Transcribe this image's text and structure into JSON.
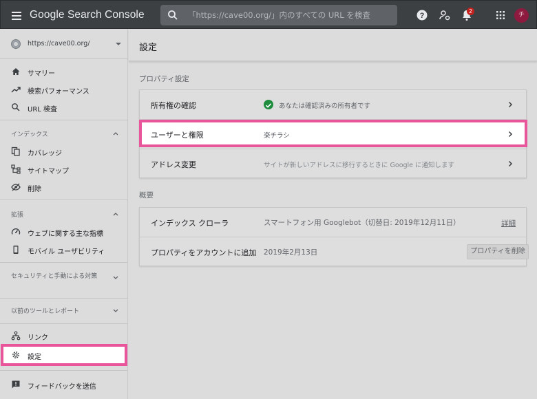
{
  "app": {
    "logo_text": "Google Search Console",
    "search_placeholder": "「https://cave00.org/」内のすべての URL を検査",
    "notification_count": "2",
    "avatar_letter": "チ"
  },
  "sidebar": {
    "property_url": "https://cave00.org/",
    "items_top": [
      {
        "label": "サマリー",
        "icon": "home-icon"
      },
      {
        "label": "検索パフォーマンス",
        "icon": "trending-up-icon"
      },
      {
        "label": "URL 検査",
        "icon": "search-icon"
      }
    ],
    "section_index": {
      "label": "インデックス",
      "items": [
        {
          "label": "カバレッジ",
          "icon": "file-copy-icon"
        },
        {
          "label": "サイトマップ",
          "icon": "sitemap-icon"
        },
        {
          "label": "削除",
          "icon": "visibility-off-icon"
        }
      ]
    },
    "section_enhancements": {
      "label": "拡張",
      "items": [
        {
          "label": "ウェブに関する主な指標",
          "icon": "speed-icon"
        },
        {
          "label": "モバイル ユーザビリティ",
          "icon": "smartphone-icon"
        }
      ]
    },
    "section_security": {
      "label": "セキュリティと手動による対策"
    },
    "section_legacy": {
      "label": "以前のツールとレポート"
    },
    "items_bottom": [
      {
        "label": "リンク",
        "icon": "links-icon"
      },
      {
        "label": "設定",
        "icon": "settings-icon"
      }
    ],
    "feedback": {
      "label": "フィードバックを送信",
      "icon": "feedback-icon"
    }
  },
  "main": {
    "page_title": "設定",
    "property_settings": {
      "title": "プロパティ設定",
      "rows": [
        {
          "label": "所有権の確認",
          "value": "あなたは確認済みの所有者です"
        },
        {
          "label": "ユーザーと権限",
          "value": "楽チラシ"
        },
        {
          "label": "アドレス変更",
          "value": "サイトが新しいアドレスに移行するときに Google に通知します"
        }
      ]
    },
    "overview": {
      "title": "概要",
      "rows": [
        {
          "label": "インデックス クローラ",
          "value": "スマートフォン用 Googlebot（切替日: 2019年12月11日）",
          "action": "詳細"
        },
        {
          "label": "プロパティをアカウントに追加",
          "value": "2019年2月13日",
          "action": "プロパティを削除"
        }
      ]
    }
  },
  "colors": {
    "topbar": "#3c4043",
    "highlight": "#e8559a",
    "check_green": "#1e8e3e",
    "badge_red": "#c5221f",
    "avatar": "#8e1b3f"
  }
}
